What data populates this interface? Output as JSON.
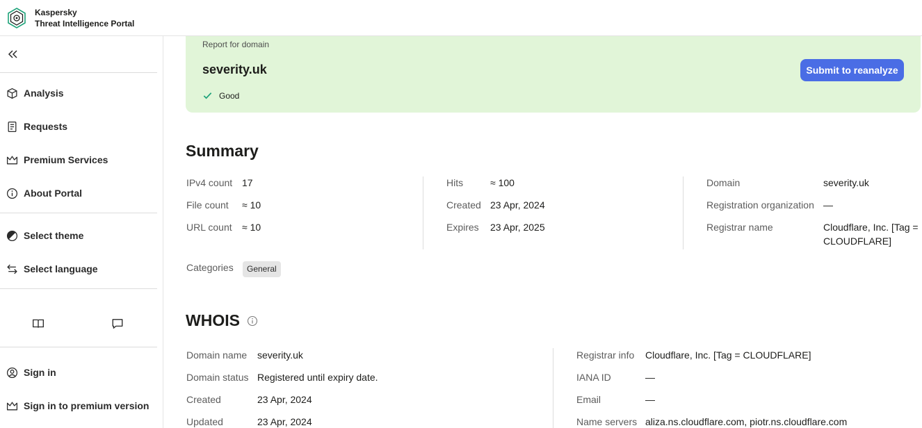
{
  "header": {
    "brand_top": "Kaspersky",
    "brand_bottom": "Threat Intelligence Portal"
  },
  "sidebar": {
    "nav": [
      {
        "label": "Analysis",
        "icon": "cube-icon"
      },
      {
        "label": "Requests",
        "icon": "document-icon"
      },
      {
        "label": "Premium Services",
        "icon": "crown-icon"
      },
      {
        "label": "About Portal",
        "icon": "info-icon"
      }
    ],
    "settings": [
      {
        "label": "Select theme",
        "icon": "theme-icon"
      },
      {
        "label": "Select language",
        "icon": "language-icon"
      }
    ],
    "account": [
      {
        "label": "Sign in",
        "icon": "user-icon"
      },
      {
        "label": "Sign in to premium version",
        "icon": "crown-icon"
      }
    ]
  },
  "report": {
    "label": "Report for domain",
    "domain": "severity.uk",
    "status": "Good",
    "submit_label": "Submit to reanalyze",
    "status_color": "#1fa37a",
    "card_color": "#e1f5d8",
    "accent": "#4a6de5"
  },
  "summary": {
    "title": "Summary",
    "col1": [
      {
        "label": "IPv4 count",
        "value": "17"
      },
      {
        "label": "File count",
        "value": "≈ 10"
      },
      {
        "label": "URL count",
        "value": "≈ 10"
      }
    ],
    "col2": [
      {
        "label": "Hits",
        "value": "≈ 100"
      },
      {
        "label": "Created",
        "value": "23 Apr, 2024"
      },
      {
        "label": "Expires",
        "value": "23 Apr, 2025"
      }
    ],
    "col3": [
      {
        "label": "Domain",
        "value": "severity.uk"
      },
      {
        "label": "Registration organization",
        "value": "—"
      },
      {
        "label": "Registrar name",
        "value": "Cloudflare, Inc. [Tag = CLOUDFLARE]"
      }
    ],
    "categories_label": "Categories",
    "category": "General"
  },
  "whois": {
    "title": "WHOIS",
    "left": [
      {
        "label": "Domain name",
        "value": "severity.uk"
      },
      {
        "label": "Domain status",
        "value": "Registered until expiry date."
      },
      {
        "label": "Created",
        "value": "23 Apr, 2024"
      },
      {
        "label": "Updated",
        "value": "23 Apr, 2024"
      }
    ],
    "right": [
      {
        "label": "Registrar info",
        "value": "Cloudflare, Inc. [Tag = CLOUDFLARE]"
      },
      {
        "label": "IANA ID",
        "value": "—"
      },
      {
        "label": "Email",
        "value": "—"
      },
      {
        "label": "Name servers",
        "value": "aliza.ns.cloudflare.com, piotr.ns.cloudflare.com"
      }
    ]
  }
}
